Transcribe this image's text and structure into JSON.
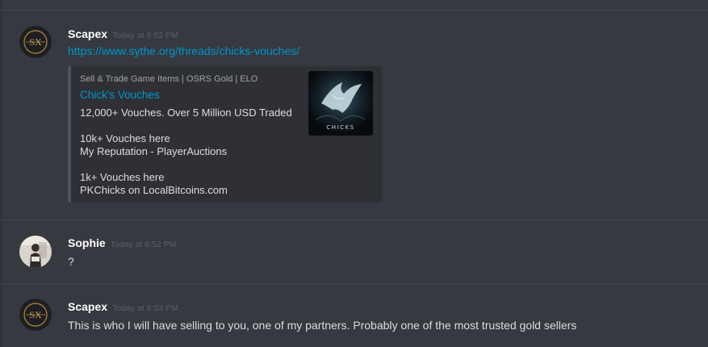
{
  "messages": [
    {
      "username": "Scapex",
      "timestamp": "Today at 6:52 PM",
      "avatar_icon": "sx-logo-icon",
      "link": "https://www.sythe.org/threads/chicks-vouches/",
      "embed": {
        "provider": "Sell & Trade Game Items | OSRS Gold | ELO",
        "title": "Chick's Vouches",
        "lines": [
          "12,000+ Vouches. Over 5 Million USD Traded",
          "10k+ Vouches here",
          "My Reputation - PlayerAuctions",
          "1k+ Vouches here",
          "PKChicks on LocalBitcoins.com"
        ],
        "thumbnail_icon": "chicks-eagle-logo-icon",
        "thumbnail_text": "CHICKS"
      }
    },
    {
      "username": "Sophie",
      "timestamp": "Today at 6:52 PM",
      "avatar_icon": "user-photo-avatar",
      "text": "?"
    },
    {
      "username": "Scapex",
      "timestamp": "Today at 6:53 PM",
      "avatar_icon": "sx-logo-icon",
      "text": "This is who I will have selling to you, one of my partners. Probably one of the most trusted gold sellers"
    }
  ],
  "colors": {
    "background": "#36393f",
    "username": "#ffffff",
    "timestamp": "#5d6066",
    "link": "#0096cf",
    "text": "#dcddde",
    "embed_bg": "#2e3035",
    "embed_border": "#4f545c"
  }
}
